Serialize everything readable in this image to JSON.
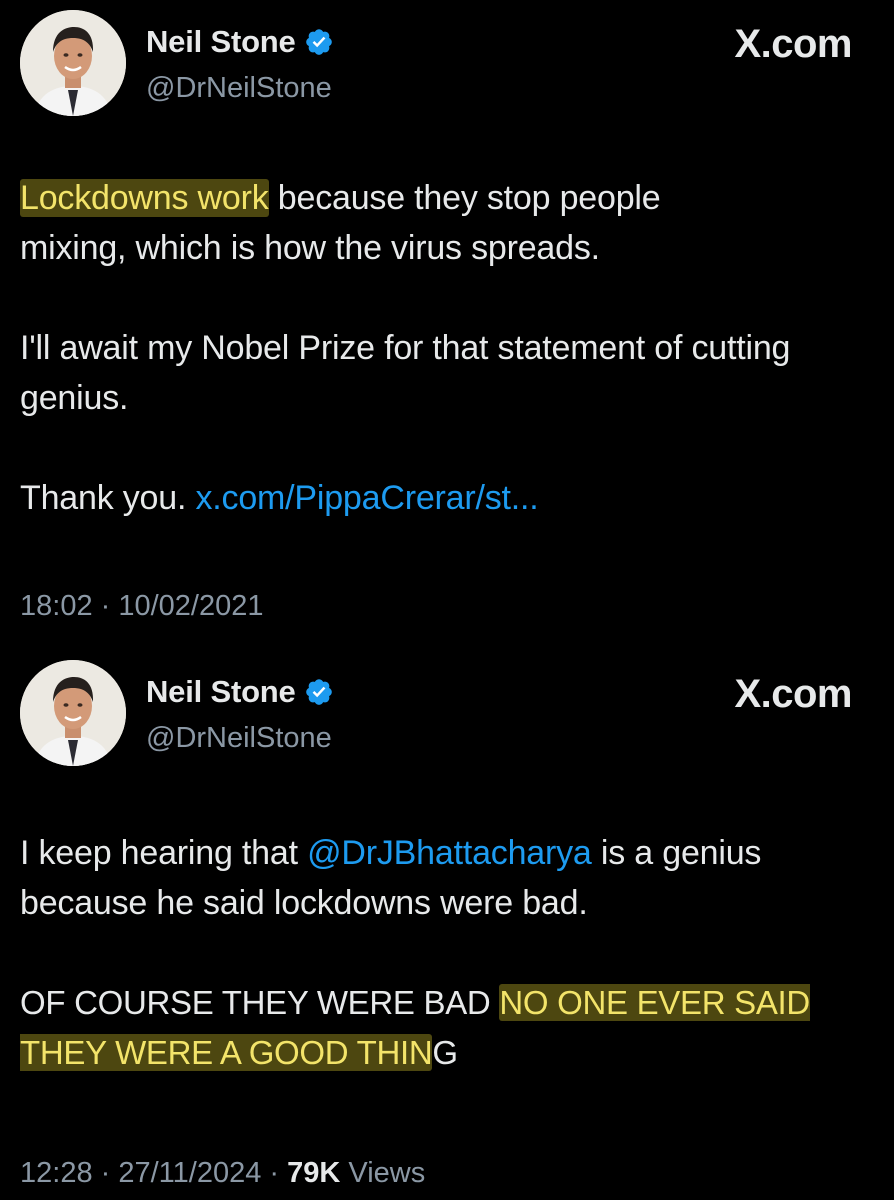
{
  "tweets": [
    {
      "author": {
        "name": "Neil Stone",
        "handle": "@DrNeilStone",
        "verified": true,
        "avatar_icon": "profile-photo"
      },
      "brand": "X.com",
      "body": {
        "p1_highlight": "Lockdowns work",
        "p1_line1_rest": " because they stop people",
        "p1_line2": "mixing, which is how the virus spreads.",
        "p2": "I'll await my Nobel Prize for that statement of cutting genius.",
        "p3_text": "Thank you. ",
        "p3_link": "x.com/PippaCrerar/st..."
      },
      "timestamp": "18:02 · 10/02/2021"
    },
    {
      "author": {
        "name": "Neil Stone",
        "handle": "@DrNeilStone",
        "verified": true,
        "avatar_icon": "profile-photo"
      },
      "brand": "X.com",
      "body": {
        "p1_text_before": "I keep hearing that ",
        "p1_mention": "@DrJBhattacharya",
        "p1_text_after": " is a genius because he said lockdowns were bad.",
        "p2_text": "OF COURSE THEY WERE BAD ",
        "p2_highlight": "NO ONE EVER SAID THEY WERE A GOOD THIN",
        "p2_tail": "G"
      },
      "timestamp": "12:28 · 27/11/2024 · ",
      "views_count": "79K",
      "views_label": " Views"
    }
  ],
  "colors": {
    "background": "#000000",
    "text": "#e7e9ea",
    "muted": "#8b98a5",
    "link": "#1d9bf0",
    "verified": "#1d9bf0",
    "highlight": "#d6c42c"
  }
}
